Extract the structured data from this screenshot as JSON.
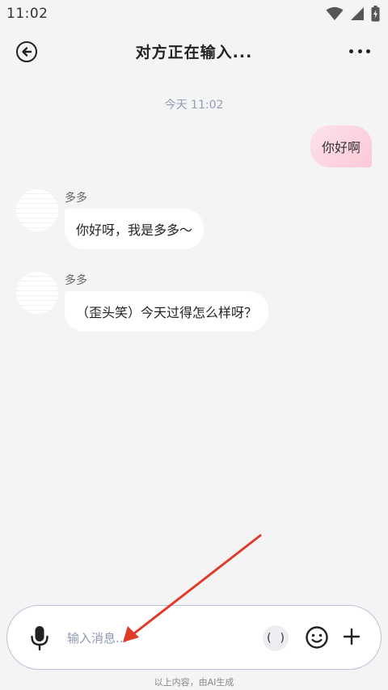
{
  "status_bar": {
    "time": "11:02"
  },
  "header": {
    "title": "对方正在输入..."
  },
  "chat": {
    "timestamp": "今天 11:02",
    "messages": [
      {
        "direction": "out",
        "text": "你好啊"
      },
      {
        "direction": "in",
        "sender": "多多",
        "text": "你好呀，我是多多～"
      },
      {
        "direction": "in",
        "sender": "多多",
        "text": "（歪头笑）今天过得怎么样呀？"
      }
    ]
  },
  "input_bar": {
    "placeholder": "输入消息...",
    "paren_label": "( )"
  },
  "footer": {
    "note": "以上内容，由AI生成"
  },
  "icons": {
    "back": "back-circle-arrow-icon",
    "more": "more-dots-icon",
    "mic": "microphone-icon",
    "emoji": "smiley-icon",
    "plus": "plus-icon"
  },
  "colors": {
    "background": "#f4f4f5",
    "outgoing_bubble": "#fbc9d7",
    "incoming_bubble": "#ffffff",
    "annotation_arrow": "#e03a2b"
  }
}
